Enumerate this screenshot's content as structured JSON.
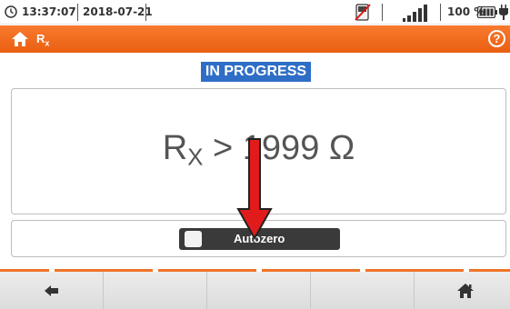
{
  "status_bar": {
    "time": "13:37:07",
    "date": "2018-07-21",
    "battery_percent": "100 %",
    "icons": [
      "clock-icon",
      "card-icon",
      "signal-icon",
      "battery-icon",
      "plug-icon"
    ]
  },
  "title_bar": {
    "title_main": "R",
    "title_sub": "x",
    "help_label": "?",
    "icons": [
      "home-icon",
      "help-icon"
    ],
    "accent_color": "#f07427"
  },
  "measurement": {
    "state_label": "IN PROGRESS",
    "state_color": "#2f6ec6",
    "result_symbol": "R",
    "result_symbol_sub": "X",
    "result_rest": " > 1999 Ω"
  },
  "options": {
    "autozero_label": "Autozero",
    "autozero_checked": false
  },
  "bottom_bar": {
    "icons": [
      "back-arrow-icon",
      "home-icon"
    ]
  }
}
